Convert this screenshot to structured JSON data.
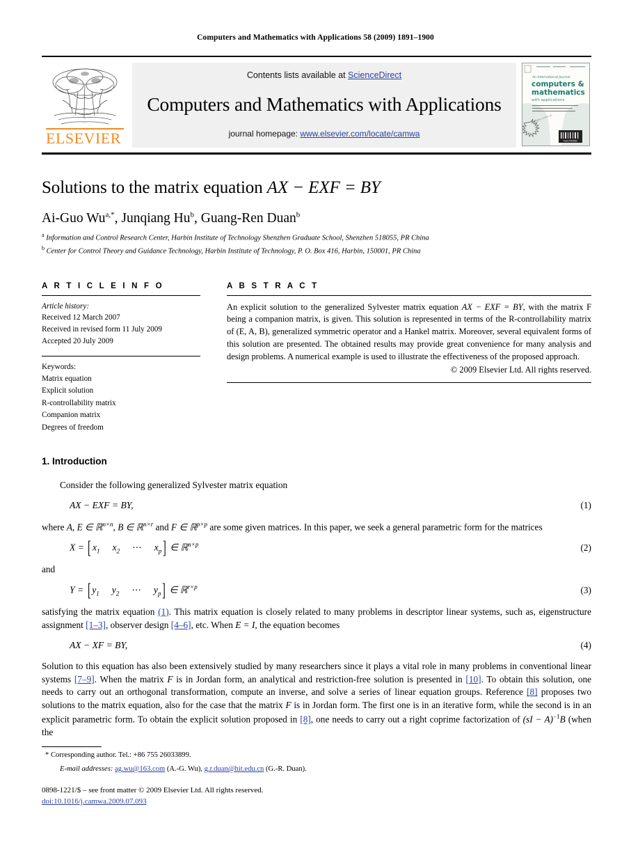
{
  "running_head": "Computers and Mathematics with Applications 58 (2009) 1891–1900",
  "masthead": {
    "publisher_name": "ELSEVIER",
    "contents_prefix": "Contents lists available at ",
    "contents_link": "ScienceDirect",
    "journal_title": "Computers and Mathematics with Applications",
    "homepage_prefix": "journal homepage: ",
    "homepage_link": "www.elsevier.com/locate/camwa",
    "cover": {
      "line1": "computers &",
      "line2": "mathematics",
      "line3": "with applications",
      "kicker": "An International Journal"
    }
  },
  "article": {
    "title_text": "Solutions to the matrix equation ",
    "title_math": "AX − EXF = BY",
    "authors": [
      {
        "name": "Ai-Guo Wu",
        "marks": "a,*"
      },
      {
        "name": "Junqiang Hu",
        "marks": "b"
      },
      {
        "name": "Guang-Ren Duan",
        "marks": "b"
      }
    ],
    "affiliations": [
      {
        "mark": "a",
        "text": "Information and Control Research Center, Harbin Institute of Technology Shenzhen Graduate School, Shenzhen 518055, PR China"
      },
      {
        "mark": "b",
        "text": "Center for Control Theory and Guidance Technology, Harbin Institute of Technology, P. O. Box 416, Harbin, 150001, PR China"
      }
    ]
  },
  "article_info": {
    "heading": "A R T I C L E   I N F O",
    "history_label": "Article history:",
    "history": [
      "Received 12 March 2007",
      "Received in revised form 11 July 2009",
      "Accepted 20 July 2009"
    ],
    "keywords_label": "Keywords:",
    "keywords": [
      "Matrix equation",
      "Explicit solution",
      "R-controllability matrix",
      "Companion matrix",
      "Degrees of freedom"
    ]
  },
  "abstract": {
    "heading": "A B S T R A C T",
    "part1": "An explicit solution to the generalized Sylvester matrix equation ",
    "equation": "AX − EXF = BY",
    "part2": ", with the matrix F being a companion matrix, is given. This solution is represented in terms of the R-controllability matrix of (E, A, B), generalized symmetric operator and a Hankel matrix. Moreover, several equivalent forms of this solution are presented. The obtained results may provide great convenience for many analysis and design problems. A numerical example is used to illustrate the effectiveness of the proposed approach.",
    "copyright": "© 2009 Elsevier Ltd. All rights reserved."
  },
  "body": {
    "section_number_title": "1.  Introduction",
    "p1": "Consider the following generalized Sylvester matrix equation",
    "eq1": {
      "content": "AX − EXF = BY,",
      "number": "(1)"
    },
    "p2_a": "where ",
    "p2_b": " are some given matrices. In this paper, we seek a general parametric form for the matrices",
    "dim_A_E": "A, E ∈ ℝ",
    "dim_A_E_sup": "n×n",
    "dim_B": "B ∈ ℝ",
    "dim_B_sup": "n×r",
    "dim_F": "F ∈ ℝ",
    "dim_F_sup": "p×p",
    "eq2": {
      "lhs": "X =",
      "entries": [
        "x",
        "x",
        "x"
      ],
      "subs": [
        "1",
        "2",
        "p"
      ],
      "space_sym": "⋯",
      "set": "∈ ℝ",
      "set_sup": "n×p",
      "number": "(2)"
    },
    "conjunction": "and",
    "eq3": {
      "lhs": "Y =",
      "entries": [
        "y",
        "y",
        "y"
      ],
      "subs": [
        "1",
        "2",
        "p"
      ],
      "space_sym": "⋯",
      "set": "∈ ℝ",
      "set_sup": "r×p",
      "number": "(3)"
    },
    "p3_a": "satisfying the matrix equation ",
    "p3_cite1": "(1)",
    "p3_b": ". This matrix equation is closely related to many problems in descriptor linear systems, such as, eigenstructure assignment ",
    "p3_cite2": "[1–3]",
    "p3_c": ", observer design ",
    "p3_cite3": "[4–6]",
    "p3_d": ", etc. When ",
    "p3_math": "E = I",
    "p3_e": ", the equation becomes",
    "eq4": {
      "content": "AX − XF = BY,",
      "number": "(4)"
    },
    "p4_a": "Solution to this equation has also been extensively studied by many researchers since it plays a vital role in many problems in conventional linear systems ",
    "p4_cite1": "[7–9]",
    "p4_b": ". When the matrix ",
    "p4_m1": "F",
    "p4_c": " is in Jordan form, an analytical and restriction-free solution is presented in ",
    "p4_cite2": "[10]",
    "p4_d": ". To obtain this solution, one needs to carry out an orthogonal transformation, compute an inverse, and solve a series of linear equation groups. Reference ",
    "p4_cite3": "[8]",
    "p4_e": " proposes two solutions to the matrix equation, also for the case that the matrix ",
    "p4_m2": "F",
    "p4_f": " is in Jordan form. The first one is in an iterative form, while the second is in an explicit parametric form. To obtain the explicit solution proposed in ",
    "p4_cite4": "[8]",
    "p4_g": ", one needs to carry out a right coprime factorization of ",
    "p4_math_end": "(sI − A)",
    "p4_math_sup": "−1",
    "p4_math_b": "B",
    "p4_h": " (when the"
  },
  "footnotes": {
    "corresponding": "* Corresponding author. Tel.: +86 755 26033899.",
    "email_label": "E-mail addresses:",
    "email1": "ag.wu@163.com",
    "email1_owner": " (A.-G. Wu),",
    "email2": "g.r.duan@hit.edu.cn",
    "email2_owner": " (G.-R. Duan)."
  },
  "footer": {
    "issn_line": "0898-1221/$ – see front matter © 2009 Elsevier Ltd. All rights reserved.",
    "doi": "doi:10.1016/j.camwa.2009.07.093"
  },
  "colors": {
    "link": "#2A3F9D",
    "elsevier_orange": "#F08C1E",
    "panel_bg": "#f0f0f0"
  }
}
